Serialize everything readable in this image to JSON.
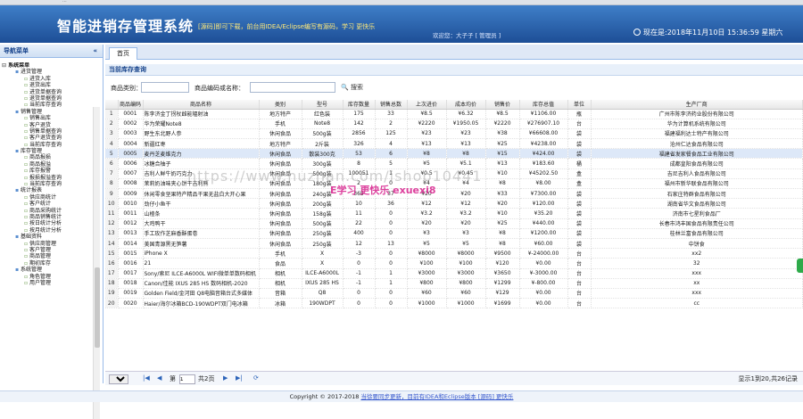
{
  "browser": {
    "url": "..."
  },
  "header": {
    "title": "智能进销存管理系统",
    "notice": "[源码]即可下载，前台用IDEA/Eclipse编写有源码，学习 更快乐",
    "user": "欢迎您：大子子 [ 管理员 ]",
    "clock": "现在是:2018年11月10日 15:36:59 星期六"
  },
  "sidebar": {
    "title": "导航菜单",
    "collapse": "«",
    "root": "系统菜单",
    "groups": [
      {
        "label": "进货管理",
        "items": [
          "进货入库",
          "退货出库",
          "进货单据查询",
          "退货单据查询",
          "当前库存查询"
        ]
      },
      {
        "label": "销售管理",
        "items": [
          "销售出库",
          "客户退货",
          "销售单据查询",
          "客户退货查询",
          "当前库存查询"
        ]
      },
      {
        "label": "库存管理",
        "items": [
          "商品报损",
          "商品报溢",
          "库存报警",
          "报损报溢查询",
          "当前库存查询"
        ]
      },
      {
        "label": "统计报表",
        "items": [
          "供应商统计",
          "客户统计",
          "商品采购统计",
          "商品销售统计",
          "按日统计分析",
          "按月统计分析"
        ]
      },
      {
        "label": "基础资料",
        "items": [
          "供应商管理",
          "客户管理",
          "商品管理",
          "期初库存"
        ]
      },
      {
        "label": "系统管理",
        "items": [
          "角色管理",
          "用户管理"
        ]
      }
    ]
  },
  "tabs": {
    "home": "首页"
  },
  "panel": {
    "title": "当前库存查询"
  },
  "search": {
    "type_label": "商品类别：",
    "name_label": "商品编码或名称：",
    "button": "搜索"
  },
  "grid": {
    "columns": [
      "",
      "商品编码",
      "商品名称",
      "类别",
      "型号",
      "库存数量",
      "销售总数",
      "上次进价",
      "成本均价",
      "销售价",
      "库存总值",
      "单位",
      "生产厂商"
    ],
    "rows": [
      [
        "1",
        "0001",
        "陈李济金丁拐杖雌能辐射油",
        "地方特产",
        "红色装",
        "175",
        "33",
        "¥8.5",
        "¥6.32",
        "¥8.5",
        "¥1106.00",
        "瓶",
        "广州市陈李济药业股份有限公司"
      ],
      [
        "2",
        "0002",
        "华为荣耀Note8",
        "手机",
        "Note8",
        "142",
        "2",
        "¥2220",
        "¥1950.05",
        "¥2220",
        "¥276907.10",
        "台",
        "华为计算机系统有限公司"
      ],
      [
        "3",
        "0003",
        "野生东北野人参",
        "休闲食品",
        "500g装",
        "2856",
        "125",
        "¥23",
        "¥23",
        "¥38",
        "¥66608.00",
        "袋",
        "福建福利达士特产有限公司"
      ],
      [
        "4",
        "0004",
        "新疆红枣",
        "地方特产",
        "2斤装",
        "326",
        "4",
        "¥13",
        "¥13",
        "¥25",
        "¥4238.00",
        "袋",
        "沧州仁达食品有限公司"
      ],
      [
        "5",
        "0005",
        "麦丹芝麦维克力",
        "休闲食品",
        "散装300克",
        "53",
        "6",
        "¥8",
        "¥8",
        "¥15",
        "¥424.00",
        "袋",
        "福建省发家餐食品工业有限公司"
      ],
      [
        "6",
        "0006",
        "冰糖合柚子",
        "休闲食品",
        "300g装",
        "8",
        "5",
        "¥5",
        "¥5.1",
        "¥13",
        "¥183.60",
        "桶",
        "成都皇阳食品有限公司"
      ],
      [
        "7",
        "0007",
        "吉利人鲜牛奶巧克力",
        "休闲食品",
        "500g装",
        "100051",
        "1",
        "¥0.5",
        "¥0.45",
        "¥10",
        "¥45202.50",
        "盒",
        "吉尼吉利人食品有限公司"
      ],
      [
        "8",
        "0008",
        "茉莉奶油味夹心饼干吉利熊",
        "休闲食品",
        "180g装",
        "2",
        "0",
        "¥4",
        "¥4",
        "¥8",
        "¥8.00",
        "盒",
        "福州市新华联食品有限公司"
      ],
      [
        "9",
        "0009",
        "休闲零食坚果特产精品干果无盐白大开心果",
        "休闲食品",
        "240g装",
        "365",
        "37",
        "¥20",
        "¥20",
        "¥33",
        "¥7300.00",
        "袋",
        "石家庄特群食品有限公司"
      ],
      [
        "10",
        "0010",
        "劲仔小鱼干",
        "休闲食品",
        "200g装",
        "10",
        "36",
        "¥12",
        "¥12",
        "¥20",
        "¥120.00",
        "袋",
        "湖南省华文食品有限公司"
      ],
      [
        "11",
        "0011",
        "山楂条",
        "休闲食品",
        "158g装",
        "11",
        "0",
        "¥3.2",
        "¥3.2",
        "¥10",
        "¥35.20",
        "袋",
        "济南市七星利食品厂"
      ],
      [
        "12",
        "0012",
        "大鸡鸭干",
        "休闲食品",
        "500g装",
        "22",
        "0",
        "¥20",
        "¥20",
        "¥25",
        "¥440.00",
        "袋",
        "长春市鸿丰国食品有限责任公司"
      ],
      [
        "13",
        "0013",
        "手工玫作芝麻香酥蛋卷",
        "休闲食品",
        "250g装",
        "400",
        "0",
        "¥3",
        "¥3",
        "¥8",
        "¥1200.00",
        "袋",
        "桂林兰富食品有限公司"
      ],
      [
        "14",
        "0014",
        "美国青源黑无笋薯",
        "休闲食品",
        "250g装",
        "12",
        "13",
        "¥5",
        "¥5",
        "¥8",
        "¥60.00",
        "袋",
        "中饼食"
      ],
      [
        "15",
        "0015",
        "iPhone X",
        "手机",
        "X",
        "-3",
        "0",
        "¥8000",
        "¥8000",
        "¥9500",
        "¥-24000.00",
        "台",
        "xx2"
      ],
      [
        "16",
        "0016",
        "21",
        "食品",
        "X",
        "0",
        "0",
        "¥100",
        "¥100",
        "¥120",
        "¥0.00",
        "台",
        "32"
      ],
      [
        "17",
        "0017",
        "Sony/索尼 ILCE-A6000L WIFI微单单数码相机",
        "相机",
        "ILCE-A6000L",
        "-1",
        "1",
        "¥3000",
        "¥3000",
        "¥3650",
        "¥-3000.00",
        "台",
        "xxx"
      ],
      [
        "18",
        "0018",
        "Canon/佳能 IXUS 285 HS 数码相机-2020",
        "相机",
        "IXUS 285 HS",
        "-1",
        "1",
        "¥800",
        "¥800",
        "¥1299",
        "¥-800.00",
        "台",
        "xx"
      ],
      [
        "19",
        "0019",
        "Golden Field/金河田 Q8电脑音箱台式多媒体",
        "音箱",
        "Q8",
        "0",
        "0",
        "¥60",
        "¥60",
        "¥129",
        "¥0.00",
        "台",
        "xxx"
      ],
      [
        "20",
        "0020",
        "Haier/海尔冰箱BCD-190WDPT双门电冰箱",
        "冰箱",
        "190WDPT",
        "0",
        "0",
        "¥1000",
        "¥1000",
        "¥1699",
        "¥0.00",
        "台",
        "cc"
      ]
    ]
  },
  "pager": {
    "size": "20",
    "page_label": "第",
    "page": "1",
    "total_pages": "共2页",
    "summary": "显示1到20,共26记录"
  },
  "footer": {
    "text": "Copyright © 2017-2018 ",
    "link": "当徐要同步更新，目前有IDEA和Eclipse版本 [源码] 更快乐"
  },
  "watermark": {
    "url": "https://www.huzhan.com/ishop10441",
    "slogan": "E学习 更快乐 exuexi8"
  }
}
